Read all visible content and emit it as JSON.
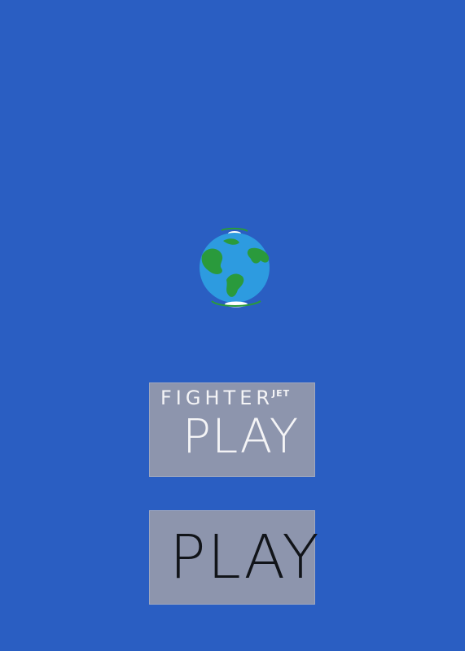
{
  "colors": {
    "background": "#2a5ec2",
    "button_fill": "#8d95ad",
    "ocean": "#2d9be0",
    "land": "#2a9a3c",
    "ice": "#ffffff",
    "light_text": "#f4f4f6",
    "dark_text": "#111419"
  },
  "globe": {
    "icon": "earth-globe-icon"
  },
  "buttons": {
    "fighter_play": {
      "title": "FIGHTER",
      "title_suffix": "JET",
      "label": "PLAY"
    },
    "play": {
      "label": "PLAY"
    }
  }
}
